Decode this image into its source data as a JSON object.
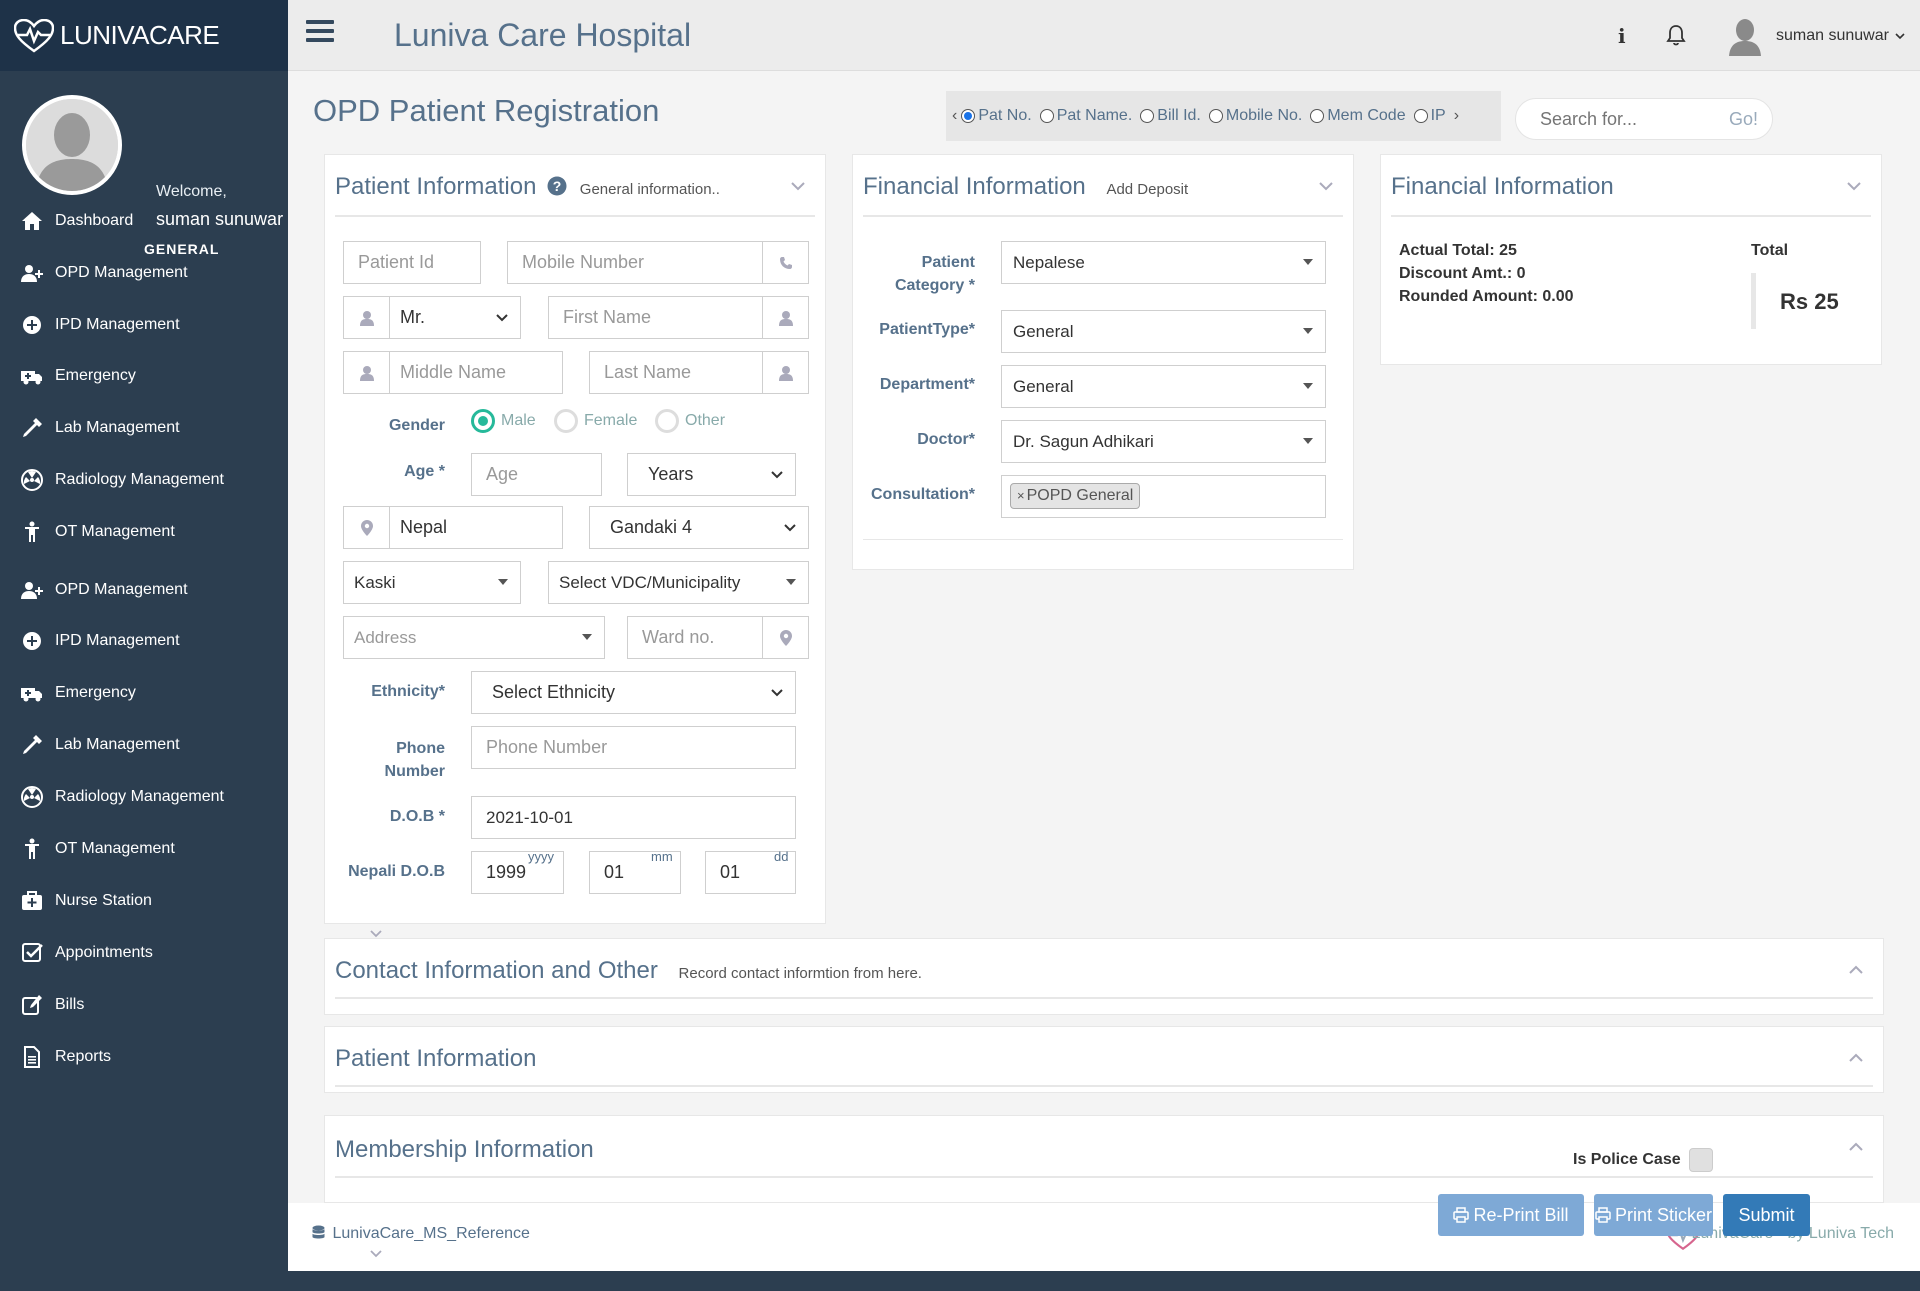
{
  "brand": {
    "name": "LUNIVACARE"
  },
  "sidebar": {
    "welcome": "Welcome,",
    "user_name": "suman sunuwar",
    "role": "GENERAL",
    "items": [
      {
        "label": "Dashboard",
        "icon": "home-icon"
      },
      {
        "label": "OPD Management",
        "icon": "user-plus-icon"
      },
      {
        "label": "IPD Management",
        "icon": "plus-circle-icon"
      },
      {
        "label": "Emergency",
        "icon": "ambulance-icon"
      },
      {
        "label": "Lab Management",
        "icon": "eyedropper-icon"
      },
      {
        "label": "Radiology Management",
        "icon": "radiation-icon"
      },
      {
        "label": "OT Management",
        "icon": "child-icon"
      },
      {
        "label": "OPD Management",
        "icon": "user-plus-icon"
      },
      {
        "label": "IPD Management",
        "icon": "plus-circle-icon"
      },
      {
        "label": "Emergency",
        "icon": "ambulance-icon"
      },
      {
        "label": "Lab Management",
        "icon": "eyedropper-icon"
      },
      {
        "label": "Radiology Management",
        "icon": "radiation-icon"
      },
      {
        "label": "OT Management",
        "icon": "child-icon"
      },
      {
        "label": "Nurse Station",
        "icon": "medkit-icon"
      },
      {
        "label": "Appointments",
        "icon": "check-square-icon"
      },
      {
        "label": "Bills",
        "icon": "edit-icon"
      },
      {
        "label": "Reports",
        "icon": "file-icon"
      }
    ]
  },
  "topbar": {
    "title": "Luniva Care Hospital",
    "user": "suman sunuwar",
    "info_glyph": "i"
  },
  "page": {
    "title": "OPD Patient Registration"
  },
  "search": {
    "options": [
      {
        "label": "Pat No.",
        "selected": true
      },
      {
        "label": "Pat Name.",
        "selected": false
      },
      {
        "label": "Bill Id.",
        "selected": false
      },
      {
        "label": "Mobile No.",
        "selected": false
      },
      {
        "label": "Mem Code",
        "selected": false
      },
      {
        "label": "IP",
        "selected": false
      }
    ],
    "prev_glyph": "‹",
    "next_glyph": "›",
    "placeholder": "Search for...",
    "go_label": "Go!"
  },
  "patient_info": {
    "title": "Patient Information",
    "subtitle": "General information..",
    "patient_id_placeholder": "Patient Id",
    "mobile_placeholder": "Mobile Number",
    "salutation": "Mr.",
    "first_name_placeholder": "First Name",
    "middle_name_placeholder": "Middle Name",
    "last_name_placeholder": "Last Name",
    "gender_label": "Gender",
    "gender_options": [
      "Male",
      "Female",
      "Other"
    ],
    "gender_selected": "Male",
    "age_label": "Age",
    "age_placeholder": "Age",
    "age_unit": "Years",
    "country": "Nepal",
    "province": "Gandaki 4",
    "district": "Kaski",
    "municipality": "Select VDC/Municipality",
    "address_placeholder": "Address",
    "ward_placeholder": "Ward no.",
    "ethnicity_label": "Ethnicity",
    "ethnicity_value": "Select Ethnicity",
    "phone_label_1": "Phone",
    "phone_label_2": "Number",
    "phone_placeholder": "Phone Number",
    "dob_label": "D.O.B",
    "dob_value": "2021-10-01",
    "nepali_dob_label": "Nepali D.O.B",
    "nepali_year": "1999",
    "nepali_month": "01",
    "nepali_day": "01",
    "yyyy": "yyyy",
    "mm": "mm",
    "dd": "dd",
    "required_mark": "*"
  },
  "financial_form": {
    "title": "Financial Information",
    "subtitle": "Add Deposit",
    "patient_category_label_1": "Patient",
    "patient_category_label_2": "Category",
    "patient_category": "Nepalese",
    "patient_type_label": "PatientType",
    "patient_type": "General",
    "department_label": "Department",
    "department": "General",
    "doctor_label": "Doctor",
    "doctor": "Dr. Sagun Adhikari",
    "consultation_label": "Consultation",
    "consultation_tag": "POPD General",
    "tag_remove": "×"
  },
  "financial_summary": {
    "title": "Financial Information",
    "actual_total": "Actual Total: 25",
    "discount": "Discount Amt.: 0",
    "rounded": "Rounded Amount: 0.00",
    "total_label": "Total",
    "total_value": "Rs 25"
  },
  "sections": {
    "contact_title": "Contact Information and Other",
    "contact_subtitle": "Record contact informtion from here.",
    "patient_info_title": "Patient Information",
    "membership_title": "Membership Information",
    "police_case_label": "Is Police Case"
  },
  "buttons": {
    "reprint": "Re-Print Bill",
    "sticker": "Print Sticker",
    "submit": "Submit"
  },
  "footer": {
    "db": "LunivaCare_MS_Reference",
    "credit": "LunivaCare - by Luniva Tech"
  },
  "colors": {
    "sidebar_bg": "#2c3e50",
    "accent_text": "#56718b",
    "radio_selected": "#26b99a",
    "submit_button": "#337ab7",
    "secondary_button": "#7ea9d6"
  }
}
